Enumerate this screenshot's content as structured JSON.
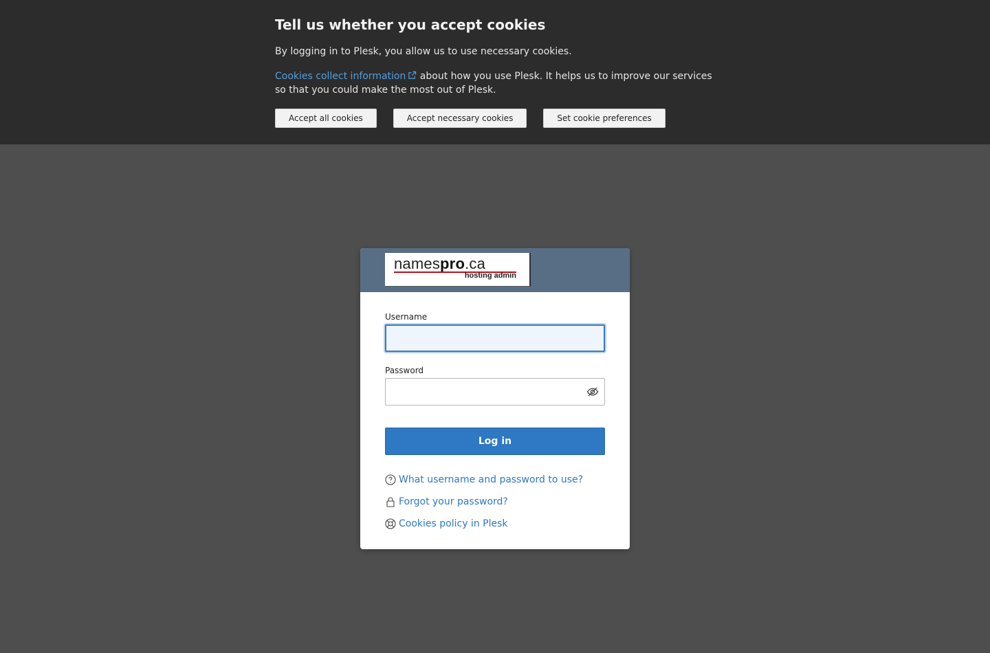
{
  "cookie_banner": {
    "title": "Tell us whether you accept cookies",
    "text_necessary": "By logging in to Plesk, you allow us to use necessary cookies.",
    "link_text": "Cookies collect information",
    "text_after_link": " about how you use Plesk. It helps us to improve our services so that you could make the most out of Plesk.",
    "buttons": {
      "accept_all": "Accept all cookies",
      "accept_necessary": "Accept necessary cookies",
      "preferences": "Set cookie preferences"
    },
    "link_color": "#4fa0e2"
  },
  "logo": {
    "name_light": "names",
    "name_bold": "pro",
    "name_suffix": ".ca",
    "subtitle": "hosting admin"
  },
  "login": {
    "username_label": "Username",
    "username_value": "",
    "password_label": "Password",
    "password_value": "",
    "submit_label": "Log in",
    "accent_color": "#2f78c4",
    "header_color": "#586e84"
  },
  "help_links": [
    {
      "icon": "question-circle-icon",
      "label": "What username and password to use?"
    },
    {
      "icon": "lock-icon",
      "label": "Forgot your password?"
    },
    {
      "icon": "lifebuoy-icon",
      "label": "Cookies policy in Plesk"
    }
  ]
}
